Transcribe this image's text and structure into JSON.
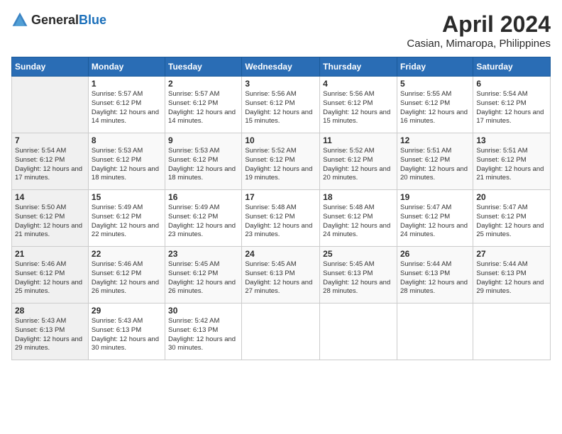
{
  "header": {
    "logo": {
      "general": "General",
      "blue": "Blue"
    },
    "title": "April 2024",
    "location": "Casian, Mimaropa, Philippines"
  },
  "calendar": {
    "days_of_week": [
      "Sunday",
      "Monday",
      "Tuesday",
      "Wednesday",
      "Thursday",
      "Friday",
      "Saturday"
    ],
    "weeks": [
      [
        {
          "day": "",
          "sunrise": "",
          "sunset": "",
          "daylight": ""
        },
        {
          "day": "1",
          "sunrise": "Sunrise: 5:57 AM",
          "sunset": "Sunset: 6:12 PM",
          "daylight": "Daylight: 12 hours and 14 minutes."
        },
        {
          "day": "2",
          "sunrise": "Sunrise: 5:57 AM",
          "sunset": "Sunset: 6:12 PM",
          "daylight": "Daylight: 12 hours and 14 minutes."
        },
        {
          "day": "3",
          "sunrise": "Sunrise: 5:56 AM",
          "sunset": "Sunset: 6:12 PM",
          "daylight": "Daylight: 12 hours and 15 minutes."
        },
        {
          "day": "4",
          "sunrise": "Sunrise: 5:56 AM",
          "sunset": "Sunset: 6:12 PM",
          "daylight": "Daylight: 12 hours and 15 minutes."
        },
        {
          "day": "5",
          "sunrise": "Sunrise: 5:55 AM",
          "sunset": "Sunset: 6:12 PM",
          "daylight": "Daylight: 12 hours and 16 minutes."
        },
        {
          "day": "6",
          "sunrise": "Sunrise: 5:54 AM",
          "sunset": "Sunset: 6:12 PM",
          "daylight": "Daylight: 12 hours and 17 minutes."
        }
      ],
      [
        {
          "day": "7",
          "sunrise": "Sunrise: 5:54 AM",
          "sunset": "Sunset: 6:12 PM",
          "daylight": "Daylight: 12 hours and 17 minutes."
        },
        {
          "day": "8",
          "sunrise": "Sunrise: 5:53 AM",
          "sunset": "Sunset: 6:12 PM",
          "daylight": "Daylight: 12 hours and 18 minutes."
        },
        {
          "day": "9",
          "sunrise": "Sunrise: 5:53 AM",
          "sunset": "Sunset: 6:12 PM",
          "daylight": "Daylight: 12 hours and 18 minutes."
        },
        {
          "day": "10",
          "sunrise": "Sunrise: 5:52 AM",
          "sunset": "Sunset: 6:12 PM",
          "daylight": "Daylight: 12 hours and 19 minutes."
        },
        {
          "day": "11",
          "sunrise": "Sunrise: 5:52 AM",
          "sunset": "Sunset: 6:12 PM",
          "daylight": "Daylight: 12 hours and 20 minutes."
        },
        {
          "day": "12",
          "sunrise": "Sunrise: 5:51 AM",
          "sunset": "Sunset: 6:12 PM",
          "daylight": "Daylight: 12 hours and 20 minutes."
        },
        {
          "day": "13",
          "sunrise": "Sunrise: 5:51 AM",
          "sunset": "Sunset: 6:12 PM",
          "daylight": "Daylight: 12 hours and 21 minutes."
        }
      ],
      [
        {
          "day": "14",
          "sunrise": "Sunrise: 5:50 AM",
          "sunset": "Sunset: 6:12 PM",
          "daylight": "Daylight: 12 hours and 21 minutes."
        },
        {
          "day": "15",
          "sunrise": "Sunrise: 5:49 AM",
          "sunset": "Sunset: 6:12 PM",
          "daylight": "Daylight: 12 hours and 22 minutes."
        },
        {
          "day": "16",
          "sunrise": "Sunrise: 5:49 AM",
          "sunset": "Sunset: 6:12 PM",
          "daylight": "Daylight: 12 hours and 23 minutes."
        },
        {
          "day": "17",
          "sunrise": "Sunrise: 5:48 AM",
          "sunset": "Sunset: 6:12 PM",
          "daylight": "Daylight: 12 hours and 23 minutes."
        },
        {
          "day": "18",
          "sunrise": "Sunrise: 5:48 AM",
          "sunset": "Sunset: 6:12 PM",
          "daylight": "Daylight: 12 hours and 24 minutes."
        },
        {
          "day": "19",
          "sunrise": "Sunrise: 5:47 AM",
          "sunset": "Sunset: 6:12 PM",
          "daylight": "Daylight: 12 hours and 24 minutes."
        },
        {
          "day": "20",
          "sunrise": "Sunrise: 5:47 AM",
          "sunset": "Sunset: 6:12 PM",
          "daylight": "Daylight: 12 hours and 25 minutes."
        }
      ],
      [
        {
          "day": "21",
          "sunrise": "Sunrise: 5:46 AM",
          "sunset": "Sunset: 6:12 PM",
          "daylight": "Daylight: 12 hours and 25 minutes."
        },
        {
          "day": "22",
          "sunrise": "Sunrise: 5:46 AM",
          "sunset": "Sunset: 6:12 PM",
          "daylight": "Daylight: 12 hours and 26 minutes."
        },
        {
          "day": "23",
          "sunrise": "Sunrise: 5:45 AM",
          "sunset": "Sunset: 6:12 PM",
          "daylight": "Daylight: 12 hours and 26 minutes."
        },
        {
          "day": "24",
          "sunrise": "Sunrise: 5:45 AM",
          "sunset": "Sunset: 6:13 PM",
          "daylight": "Daylight: 12 hours and 27 minutes."
        },
        {
          "day": "25",
          "sunrise": "Sunrise: 5:45 AM",
          "sunset": "Sunset: 6:13 PM",
          "daylight": "Daylight: 12 hours and 28 minutes."
        },
        {
          "day": "26",
          "sunrise": "Sunrise: 5:44 AM",
          "sunset": "Sunset: 6:13 PM",
          "daylight": "Daylight: 12 hours and 28 minutes."
        },
        {
          "day": "27",
          "sunrise": "Sunrise: 5:44 AM",
          "sunset": "Sunset: 6:13 PM",
          "daylight": "Daylight: 12 hours and 29 minutes."
        }
      ],
      [
        {
          "day": "28",
          "sunrise": "Sunrise: 5:43 AM",
          "sunset": "Sunset: 6:13 PM",
          "daylight": "Daylight: 12 hours and 29 minutes."
        },
        {
          "day": "29",
          "sunrise": "Sunrise: 5:43 AM",
          "sunset": "Sunset: 6:13 PM",
          "daylight": "Daylight: 12 hours and 30 minutes."
        },
        {
          "day": "30",
          "sunrise": "Sunrise: 5:42 AM",
          "sunset": "Sunset: 6:13 PM",
          "daylight": "Daylight: 12 hours and 30 minutes."
        },
        {
          "day": "",
          "sunrise": "",
          "sunset": "",
          "daylight": ""
        },
        {
          "day": "",
          "sunrise": "",
          "sunset": "",
          "daylight": ""
        },
        {
          "day": "",
          "sunrise": "",
          "sunset": "",
          "daylight": ""
        },
        {
          "day": "",
          "sunrise": "",
          "sunset": "",
          "daylight": ""
        }
      ]
    ]
  }
}
